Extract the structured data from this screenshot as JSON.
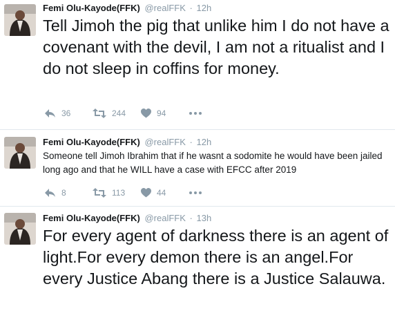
{
  "tweets": [
    {
      "author_name": "Femi Olu-Kayode(FFK)",
      "handle": "@realFFK",
      "separator": "·",
      "time": "12h",
      "text": "Tell Jimoh the pig that unlike  him I do not have a covenant with the devil, I am not a ritualist and I do not sleep in coffins for money.",
      "replies": "36",
      "retweets": "244",
      "likes": "94"
    },
    {
      "author_name": "Femi Olu-Kayode(FFK)",
      "handle": "@realFFK",
      "separator": "·",
      "time": "12h",
      "text": "Someone tell Jimoh Ibrahim that if he wasnt a sodomite he would have been jailed long ago and that he WILL have a case with EFCC after 2019",
      "replies": "8",
      "retweets": "113",
      "likes": "44"
    },
    {
      "author_name": "Femi Olu-Kayode(FFK)",
      "handle": "@realFFK",
      "separator": "·",
      "time": "13h",
      "text": "For every agent of darkness there is an agent of light.For every demon there is an angel.For every Justice Abang there is a Justice Salauwa."
    }
  ],
  "icons": {
    "reply": "reply-icon",
    "retweet": "retweet-icon",
    "like": "heart-icon",
    "more": "more-icon"
  },
  "colors": {
    "text": "#14171a",
    "muted": "#8899a6",
    "divider": "#e1e8ed"
  }
}
